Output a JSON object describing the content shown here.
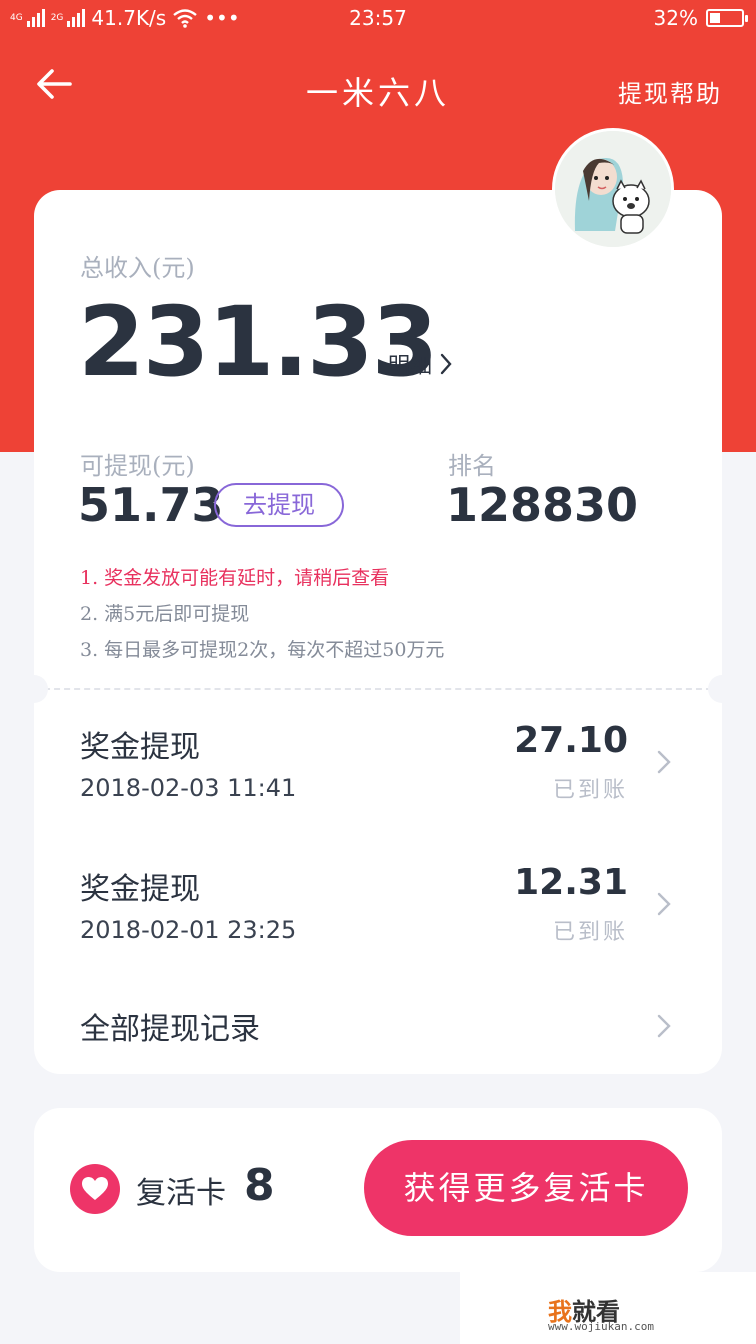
{
  "status_bar": {
    "signal_1": "4G",
    "signal_2": "2G",
    "speed": "41.7K/s",
    "more": "•••",
    "time": "23:57",
    "battery_pct": "32%",
    "battery_level": 0.32
  },
  "header": {
    "title": "一米六八",
    "help": "提现帮助"
  },
  "summary": {
    "total_label": "总收入(元)",
    "total_value": "231.33",
    "detail_label": "明细",
    "withdrawable_label": "可提现(元)",
    "withdrawable_value": "51.73",
    "withdraw_button": "去提现",
    "rank_label": "排名",
    "rank_value": "128830"
  },
  "notes": [
    "1. 奖金发放可能有延时，请稍后查看",
    "2. 满5元后即可提现",
    "3. 每日最多可提现2次，每次不超过50万元"
  ],
  "records": [
    {
      "title": "奖金提现",
      "date": "2018-02-03 11:41",
      "amount": "27.10",
      "status": "已到账"
    },
    {
      "title": "奖金提现",
      "date": "2018-02-01 23:25",
      "amount": "12.31",
      "status": "已到账"
    }
  ],
  "all_records_label": "全部提现记录",
  "revive": {
    "label": "复活卡",
    "count": "8",
    "button": "获得更多复活卡"
  },
  "watermark": {
    "brand_a": "我",
    "brand_b": "就看",
    "url": "www.wojiukan.com"
  },
  "colors": {
    "header_red": "#ee4236",
    "accent_pink": "#ee3468",
    "button_purple": "#8867d8",
    "note_red": "#e8315e"
  }
}
